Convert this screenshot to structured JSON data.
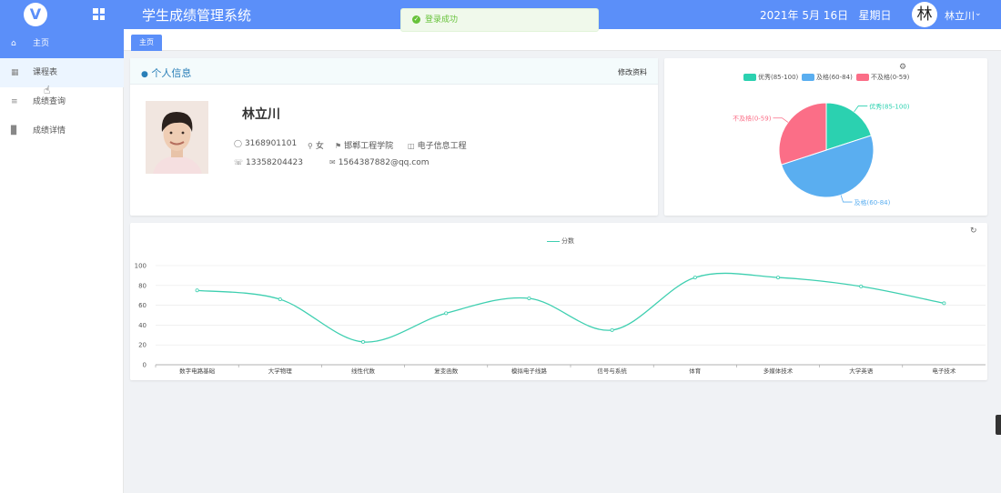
{
  "header": {
    "app_title": "学生成绩管理系统",
    "date": "2021年 5月 16日",
    "weekday": "星期日",
    "avatar_char": "林",
    "user_name": "林立川",
    "logo_char": "V"
  },
  "toast": {
    "message": "登录成功",
    "icon": "success-check-icon"
  },
  "sidebar": {
    "items": [
      {
        "label": "主页",
        "icon": "home-icon",
        "active": true
      },
      {
        "label": "课程表",
        "icon": "table-icon",
        "active": false
      },
      {
        "label": "成绩查询",
        "icon": "list-icon",
        "active": false
      },
      {
        "label": "成绩详情",
        "icon": "bar-chart-icon",
        "active": false
      }
    ]
  },
  "tabs": [
    {
      "label": "主页"
    }
  ],
  "profile": {
    "section_title": "个人信息",
    "edit_link": "修改资料",
    "name": "林立川",
    "student_id": "3168901101",
    "gender": "女",
    "school": "邯郸工程学院",
    "major": "电子信息工程",
    "phone": "13358204423",
    "email": "1564387882@qq.com"
  },
  "colors": {
    "primary": "#5b8ff9",
    "excellent": "#2bd1b0",
    "pass": "#5aaef0",
    "fail": "#fb6e87",
    "line": "#3ecfb0"
  },
  "chart_data": [
    {
      "type": "pie",
      "legend": [
        "优秀(85-100)",
        "及格(60-84)",
        "不及格(0-59)"
      ],
      "labels": [
        "优秀(85-100)",
        "及格(60-84)",
        "不及格(0-59)"
      ],
      "values": [
        2,
        5,
        3
      ],
      "legend_position": "top"
    },
    {
      "type": "line",
      "legend": [
        "分数"
      ],
      "categories": [
        "数字电路基础",
        "大学物理",
        "线性代数",
        "复变函数",
        "模拟电子线路",
        "信号与系统",
        "体育",
        "多媒体技术",
        "大学英语",
        "电子技术"
      ],
      "series": [
        {
          "name": "分数",
          "values": [
            75,
            66,
            23,
            52,
            67,
            35,
            88,
            88,
            79,
            62
          ]
        }
      ],
      "yticks": [
        "0",
        "20",
        "40",
        "60",
        "80",
        "100"
      ],
      "ylim": [
        0,
        100
      ],
      "grid": true,
      "legend_position": "top"
    }
  ]
}
